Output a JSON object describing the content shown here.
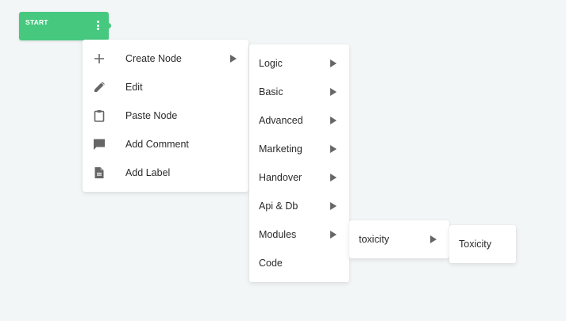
{
  "start_node": {
    "label": "START",
    "color": "#46c97e"
  },
  "context_menu": {
    "items": [
      {
        "label": "Create Node",
        "icon": "plus-icon",
        "has_submenu": true
      },
      {
        "label": "Edit",
        "icon": "pencil-icon",
        "has_submenu": false
      },
      {
        "label": "Paste Node",
        "icon": "clipboard-icon",
        "has_submenu": false
      },
      {
        "label": "Add Comment",
        "icon": "comment-icon",
        "has_submenu": false
      },
      {
        "label": "Add Label",
        "icon": "document-icon",
        "has_submenu": false
      }
    ]
  },
  "category_menu": {
    "items": [
      {
        "label": "Logic",
        "has_submenu": true
      },
      {
        "label": "Basic",
        "has_submenu": true
      },
      {
        "label": "Advanced",
        "has_submenu": true
      },
      {
        "label": "Marketing",
        "has_submenu": true
      },
      {
        "label": "Handover",
        "has_submenu": true
      },
      {
        "label": "Api & Db",
        "has_submenu": true
      },
      {
        "label": "Modules",
        "has_submenu": true
      },
      {
        "label": "Code",
        "has_submenu": false
      }
    ]
  },
  "modules_menu": {
    "items": [
      {
        "label": "toxicity",
        "has_submenu": true
      }
    ]
  },
  "toxicity_menu": {
    "items": [
      {
        "label": "Toxicity",
        "has_submenu": false
      }
    ]
  },
  "colors": {
    "background": "#f3f6f7",
    "icon": "#666666",
    "text": "#2b2b2b"
  }
}
